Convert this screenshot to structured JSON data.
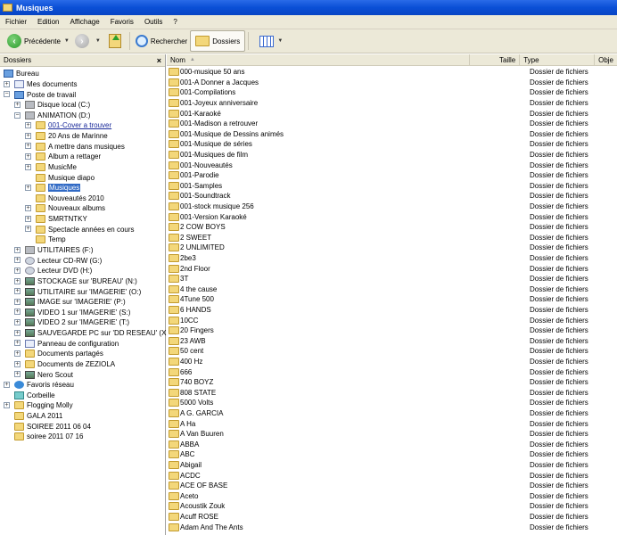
{
  "window": {
    "title": "Musiques"
  },
  "menu": [
    "Fichier",
    "Edition",
    "Affichage",
    "Favoris",
    "Outils",
    "?"
  ],
  "toolbar": {
    "back": "Précédente",
    "search": "Rechercher",
    "folders": "Dossiers"
  },
  "left_pane": {
    "title": "Dossiers",
    "close": "×",
    "tree": [
      {
        "label": "Bureau",
        "level": 0,
        "icon": "desktop",
        "exp": ""
      },
      {
        "label": "Mes documents",
        "level": 1,
        "icon": "doc",
        "exp": "+"
      },
      {
        "label": "Poste de travail",
        "level": 1,
        "icon": "pc",
        "exp": "-"
      },
      {
        "label": "Disque local (C:)",
        "level": 2,
        "icon": "drive",
        "exp": "+"
      },
      {
        "label": "ANIMATION (D:)",
        "level": 2,
        "icon": "drive",
        "exp": "-"
      },
      {
        "label": "001-Cover a trouver",
        "level": 3,
        "icon": "folder",
        "exp": "+",
        "state": "link"
      },
      {
        "label": "20 Ans de Marinne",
        "level": 3,
        "icon": "folder",
        "exp": "+"
      },
      {
        "label": "A mettre dans musiques",
        "level": 3,
        "icon": "folder",
        "exp": "+"
      },
      {
        "label": "Album a rettager",
        "level": 3,
        "icon": "folder",
        "exp": "+"
      },
      {
        "label": "MusicMe",
        "level": 3,
        "icon": "folder",
        "exp": "+"
      },
      {
        "label": "Musique diapo",
        "level": 3,
        "icon": "folder",
        "exp": ""
      },
      {
        "label": "Musiques",
        "level": 3,
        "icon": "folder",
        "exp": "+",
        "state": "selected"
      },
      {
        "label": "Nouveautés 2010",
        "level": 3,
        "icon": "folder",
        "exp": ""
      },
      {
        "label": "Nouveaux albums",
        "level": 3,
        "icon": "folder",
        "exp": "+"
      },
      {
        "label": "SMRTNTKY",
        "level": 3,
        "icon": "folder",
        "exp": "+"
      },
      {
        "label": "Spectacle années en cours",
        "level": 3,
        "icon": "folder",
        "exp": "+"
      },
      {
        "label": "Temp",
        "level": 3,
        "icon": "folder",
        "exp": ""
      },
      {
        "label": "UTILITAIRES (F:)",
        "level": 2,
        "icon": "drive",
        "exp": "+"
      },
      {
        "label": "Lecteur CD-RW (G:)",
        "level": 2,
        "icon": "cd",
        "exp": "+"
      },
      {
        "label": "Lecteur DVD (H:)",
        "level": 2,
        "icon": "cd",
        "exp": "+"
      },
      {
        "label": "STOCKAGE sur 'BUREAU' (N:)",
        "level": 2,
        "icon": "net",
        "exp": "+"
      },
      {
        "label": "UTILITAIRE sur 'IMAGERIE' (O:)",
        "level": 2,
        "icon": "net",
        "exp": "+"
      },
      {
        "label": "IMAGE sur 'IMAGERIE' (P:)",
        "level": 2,
        "icon": "net",
        "exp": "+"
      },
      {
        "label": "VIDEO 1 sur 'IMAGERIE' (S:)",
        "level": 2,
        "icon": "net",
        "exp": "+"
      },
      {
        "label": "VIDEO 2  sur 'IMAGERIE' (T:)",
        "level": 2,
        "icon": "net",
        "exp": "+"
      },
      {
        "label": "SAUVEGARDE PC sur 'DD RESEAU' (X:)",
        "level": 2,
        "icon": "net",
        "exp": "+"
      },
      {
        "label": "Panneau de configuration",
        "level": 2,
        "icon": "doc",
        "exp": "+"
      },
      {
        "label": "Documents partagés",
        "level": 2,
        "icon": "folder",
        "exp": "+"
      },
      {
        "label": "Documents de ZEZIOLA",
        "level": 2,
        "icon": "folder",
        "exp": "+"
      },
      {
        "label": "Nero Scout",
        "level": 2,
        "icon": "net",
        "exp": "+"
      },
      {
        "label": "Favoris réseau",
        "level": 1,
        "icon": "globe",
        "exp": "+"
      },
      {
        "label": "Corbeille",
        "level": 1,
        "icon": "bin",
        "exp": ""
      },
      {
        "label": "Flogging Molly",
        "level": 1,
        "icon": "folder",
        "exp": "+"
      },
      {
        "label": "GALA 2011",
        "level": 1,
        "icon": "folder",
        "exp": ""
      },
      {
        "label": "SOIREE 2011 06 04",
        "level": 1,
        "icon": "folder",
        "exp": ""
      },
      {
        "label": "soiree 2011 07 16",
        "level": 1,
        "icon": "folder",
        "exp": ""
      }
    ]
  },
  "file_list": {
    "columns": {
      "name": "Nom",
      "size": "Taille",
      "type": "Type",
      "extra": "Obje"
    },
    "type_label": "Dossier de fichiers",
    "items": [
      "000-musique 50 ans",
      "001-A Donner a Jacques",
      "001-Compilations",
      "001-Joyeux anniversaire",
      "001-Karaoké",
      "001-Madison a retrouver",
      "001-Musique de Dessins animés",
      "001-Musique de séries",
      "001-Musiques de film",
      "001-Nouveautés",
      "001-Parodie",
      "001-Samples",
      "001-Soundtrack",
      "001-stock musique 256",
      "001-Version Karaoké",
      "2 COW BOYS",
      "2 SWEET",
      "2 UNLIMITED",
      "2be3",
      "2nd Floor",
      "3T",
      "4 the cause",
      "4Tune 500",
      "6 HANDS",
      "10CC",
      "20 Fingers",
      "23 AWB",
      "50 cent",
      "400 Hz",
      "666",
      "740 BOYZ",
      "808 STATE",
      "5000 Volts",
      "A G. GARCIA",
      "A Ha",
      "A Van Buuren",
      "ABBA",
      "ABC",
      "Abigail",
      "ACDC",
      "ACE OF BASE",
      "Aceto",
      "Acoustik Zouk",
      "Acuff ROSE",
      "Adam And The Ants"
    ]
  }
}
